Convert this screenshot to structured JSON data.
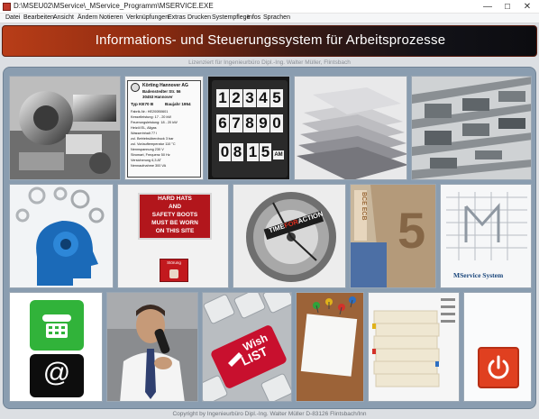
{
  "window": {
    "title": "D:\\MSEU02\\MService\\_MService_Programm\\MSERVICE.EXE",
    "controls": {
      "minimize": "—",
      "maximize": "☐",
      "close": "✕"
    }
  },
  "menu": [
    "Datei",
    "Bearbeiten",
    "Ansicht",
    "Ändern",
    "Notieren",
    "Verknüpfungen",
    "Extras",
    "Drucken",
    "Systempflege",
    "Infos",
    "Sprachen"
  ],
  "header": {
    "title": "Informations- und Steuerungssystem für Arbeitsprozesse"
  },
  "license_text": "Lizenziert für Ingenieurbüro Dipl.-Ing. Walter Müller, Flintsbach",
  "footer_text": "Copyright by Ingenieurbüro Dipl.-Ing. Walter Müller D-83126 Flintsbach/Inn",
  "nameplate": {
    "company": "Körting Hannover AG",
    "address1": "Badenstedter Str. 56",
    "address2": "30453 Hannover",
    "type": "Typ KE70 B",
    "year": "Baujahr 1954",
    "lines": [
      "Fabrik-Nr.: HE200B0601",
      "Kesselleistung: 17 - 20 kW",
      "Feuerungsleistung: 18 - 20 kW",
      "Heizöl EL, Allgas",
      "Wasserinhalt 77 l",
      "zul. Betriebsüberdruck 3 bar",
      "zul. Vorlauftemperatur 110 °C",
      "Nennspannung 230 V",
      "Stromart, Frequenz 50 Hz",
      "Versicherung 6,3 AT",
      "Nennaufnahme 300 VA"
    ]
  },
  "counter": {
    "row1": [
      "1",
      "2",
      "3",
      "4",
      "5"
    ],
    "row2": [
      "6",
      "7",
      "8",
      "9",
      "0"
    ],
    "time": [
      "0",
      "8",
      "1",
      "5"
    ],
    "ampm": "AM"
  },
  "safety_sign": {
    "line1": "HARD HATS",
    "line2": "AND",
    "line3": "SAFETY BOOTS",
    "line4": "MUST BE WORN",
    "line5": "ON THIS SITE",
    "small": "Störung"
  },
  "gear_text": {
    "part1": "TIME",
    "part2": "FOR",
    "part3": "ACTION"
  },
  "banknote": {
    "digit": "5",
    "text": "BCE ECB"
  },
  "mservice_label": "MService System",
  "at_symbol": "@",
  "wishlist": {
    "line1": "Wish",
    "line2": "LIST"
  },
  "colors": {
    "header_left": "#b83d18",
    "header_right": "#0c0c10",
    "panel": "#8a9db0",
    "phone_green": "#31b33a",
    "power_red": "#e04020"
  }
}
